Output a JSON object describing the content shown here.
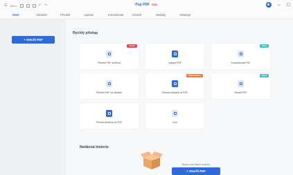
{
  "titlebar": {
    "menu_label": "Menu",
    "app_title": "iTop PDF",
    "app_badge": "Free"
  },
  "tabs": [
    {
      "label": "Start"
    },
    {
      "label": "Zobrazit"
    },
    {
      "label": "Převést"
    },
    {
      "label": "Upravit"
    },
    {
      "label": "Komentovat"
    },
    {
      "label": "Chránit"
    },
    {
      "label": "Stránky"
    },
    {
      "label": "Nástroje"
    }
  ],
  "sidebar": {
    "new_pdf_button": "+  Otevřít PDF"
  },
  "quick_access": {
    "title": "Rychlý přístup",
    "tiles": [
      {
        "label": "Převést PDF na Word",
        "badge": "Zkusit"
      },
      {
        "label": "Upravit PDF",
        "badge": ""
      },
      {
        "label": "Komprimovat PDF",
        "badge": "Nové"
      },
      {
        "label": "Převést PDF na obrázek",
        "badge": ""
      },
      {
        "label": "Převést obrázek na PDF",
        "badge": "Doporučeno"
      },
      {
        "label": "Sloučit PDF",
        "badge": "Nové"
      },
      {
        "label": "Převést soubory na PDF",
        "badge": ""
      },
      {
        "label": "Více",
        "badge": ""
      }
    ]
  },
  "recent": {
    "title": "Nedávná historie",
    "empty_text": "Nejsou zde žádné soubory",
    "open_button": "+  Otevřít PDF"
  },
  "colors": {
    "accent": "#2f6bd8",
    "badge_red": "#e8484c",
    "badge_orange": "#f07a2e",
    "badge_teal": "#3ec0c7"
  }
}
